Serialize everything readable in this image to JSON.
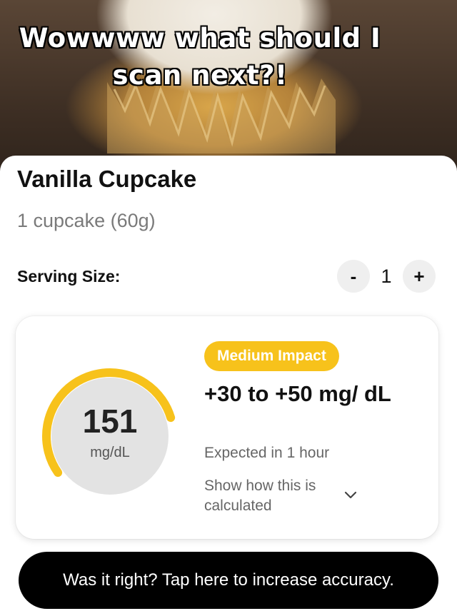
{
  "caption": {
    "line1": "Wowwww what should I",
    "line2": "scan next?!"
  },
  "food": {
    "name": "Vanilla Cupcake",
    "portion": "1 cupcake (60g)"
  },
  "serving": {
    "label": "Serving Size:",
    "minus_label": "-",
    "value": "1",
    "plus_label": "+"
  },
  "impact": {
    "glucose_value": "151",
    "glucose_unit": "mg/dL",
    "gauge_fill_fraction": 0.55,
    "badge": "Medium Impact",
    "range": "+30 to +50 mg/ dL",
    "expected": "Expected in 1 hour",
    "calc_link": "Show how this is calculated",
    "icons": {
      "chevron": "chevron-down-icon"
    }
  },
  "cta": {
    "label": "Was it right? Tap here to increase accuracy."
  },
  "colors": {
    "accent": "#f7c21b",
    "gauge_track": "#e3e3e3",
    "cta_bg": "#000000"
  }
}
